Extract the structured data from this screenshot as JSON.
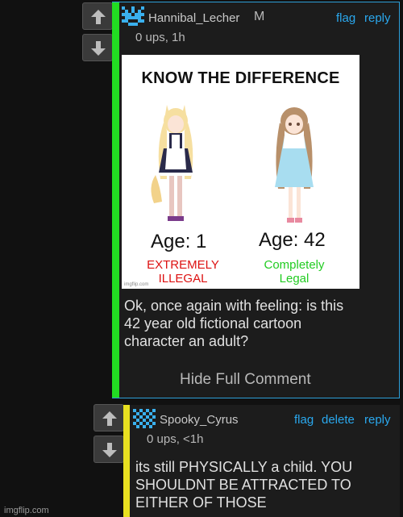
{
  "comment1": {
    "username": "Hannibal_Lecher",
    "mod_badge": "M",
    "meta": "0 ups, 1h",
    "actions": {
      "flag": "flag",
      "reply": "reply"
    },
    "meme": {
      "title": "KNOW THE DIFFERENCE",
      "left": {
        "age": "Age: 1",
        "verdict_line1": "EXTREMELY",
        "verdict_line2": "ILLEGAL",
        "verdict_color": "#dd1111"
      },
      "right": {
        "age": "Age: 42",
        "verdict_line1": "Completely",
        "verdict_line2": "Legal",
        "verdict_color": "#22cc22"
      },
      "watermark": "imgflip.com"
    },
    "body_lines": [
      "Ok, once again with feeling: is this",
      "42 year old fictional cartoon",
      "character an adult?"
    ],
    "hide_label": "Hide Full Comment",
    "accent_color": "#22dd22",
    "border_color": "#2d9fd8"
  },
  "comment2": {
    "username": "Spooky_Cyrus",
    "meta": "0 ups, <1h",
    "actions": {
      "flag": "flag",
      "delete": "delete",
      "reply": "reply"
    },
    "body_lines": [
      "its still PHYSICALLY a child. YOU",
      "SHOULDNT BE ATTRACTED TO",
      "EITHER OF THOSE"
    ],
    "accent_color": "#e8e020"
  },
  "footer_watermark": "imgflip.com",
  "icons": {
    "upvote": "arrow-up-icon",
    "downvote": "arrow-down-icon",
    "avatar": "pixel-avatar-icon"
  }
}
